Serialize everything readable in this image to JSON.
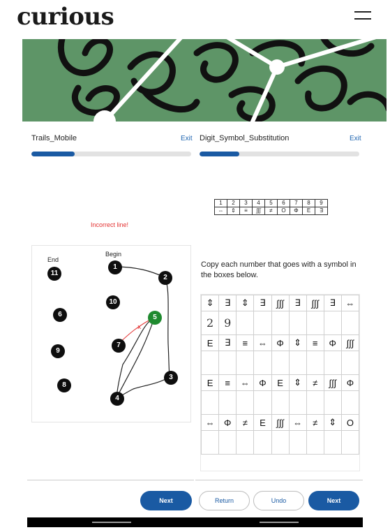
{
  "app": {
    "logo": "curious"
  },
  "header": {
    "menu_icon": "hamburger-menu-icon"
  },
  "colors": {
    "brand": "#1a5aa3",
    "banner": "#5e9567",
    "active_node": "#1f8a2f",
    "error": "#e33030"
  },
  "left_task": {
    "title": "Trails_Mobile",
    "exit_label": "Exit",
    "progress": 0.27,
    "error_message": "Incorrect line!",
    "nodes": [
      {
        "label": "1",
        "active": false
      },
      {
        "label": "2",
        "active": false
      },
      {
        "label": "3",
        "active": false
      },
      {
        "label": "4",
        "active": false
      },
      {
        "label": "5",
        "active": true
      },
      {
        "label": "6",
        "active": false
      },
      {
        "label": "7",
        "active": false
      },
      {
        "label": "8",
        "active": false
      },
      {
        "label": "9",
        "active": false
      },
      {
        "label": "10",
        "active": false
      },
      {
        "label": "11",
        "active": false
      }
    ],
    "begin_label": "Begin",
    "end_label": "End",
    "error_mark": "x"
  },
  "right_task": {
    "title": "Digit_Symbol_Substitution",
    "exit_label": "Exit",
    "progress": 0.25,
    "key": {
      "digits": [
        "1",
        "2",
        "3",
        "4",
        "5",
        "6",
        "7",
        "8",
        "9"
      ],
      "symbols": [
        "⇔",
        "⇕",
        "≡",
        "∫∫∫",
        "≠",
        "O",
        "Φ",
        "E",
        "∃"
      ]
    },
    "instruction": "Copy each number that goes with a symbol in the boxes below.",
    "grid": [
      {
        "symbols": [
          "⇕",
          "∃",
          "⇕",
          "∃",
          "∫∫∫",
          "∃",
          "∫∫∫",
          "∃",
          "⇔"
        ],
        "answers": [
          "2",
          "9",
          "",
          "",
          "",
          "",
          "",
          "",
          ""
        ]
      },
      {
        "symbols": [
          "E",
          "∃",
          "≡",
          "⇔",
          "Φ",
          "⇕",
          "≡",
          "Φ",
          "∫∫∫"
        ],
        "answers": [
          "",
          "",
          "",
          "",
          "",
          "",
          "",
          "",
          ""
        ]
      },
      {
        "symbols": [
          "E",
          "≡",
          "⇔",
          "Φ",
          "E",
          "⇕",
          "≠",
          "∫∫∫",
          "Φ"
        ],
        "answers": [
          "",
          "",
          "",
          "",
          "",
          "",
          "",
          "",
          ""
        ]
      },
      {
        "symbols": [
          "⇔",
          "Φ",
          "≠",
          "E",
          "∫∫∫",
          "⇔",
          "≠",
          "⇕",
          "O"
        ],
        "answers": [
          "",
          "",
          "",
          "",
          "",
          "",
          "",
          "",
          ""
        ]
      }
    ]
  },
  "buttons": {
    "next_left": "Next",
    "return": "Return",
    "undo": "Undo",
    "next_right": "Next"
  }
}
